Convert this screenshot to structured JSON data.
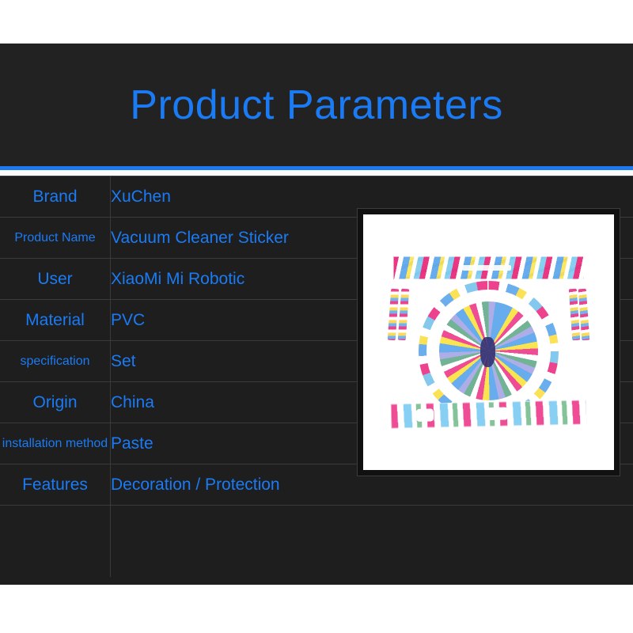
{
  "header": {
    "title": "Product Parameters"
  },
  "colors": {
    "accent_blue": "#1a7bf5",
    "panel_dark": "#1e1e1e",
    "hero_dark": "#222222",
    "grid_line": "#3a3a3a",
    "page_white": "#ffffff"
  },
  "spec_table": {
    "rows": [
      {
        "label": "Brand",
        "value": "XuChen"
      },
      {
        "label": "Product Name",
        "value": "Vacuum Cleaner Sticker"
      },
      {
        "label": "User",
        "value": "XiaoMi Mi Robotic"
      },
      {
        "label": "Material",
        "value": "PVC"
      },
      {
        "label": "specification",
        "value": "Set"
      },
      {
        "label": "Origin",
        "value": "China"
      },
      {
        "label": "installation method",
        "value": "Paste"
      },
      {
        "label": "Features",
        "value": "Decoration / Protection"
      }
    ]
  },
  "product_photo": {
    "alt": "vacuum-cleaner-sticker-set",
    "pieces": [
      "top-strip",
      "left-side-strip-1",
      "left-side-strip-2",
      "right-side-strip-1",
      "right-side-strip-2",
      "circular-top-disc",
      "bottom-strip"
    ]
  }
}
